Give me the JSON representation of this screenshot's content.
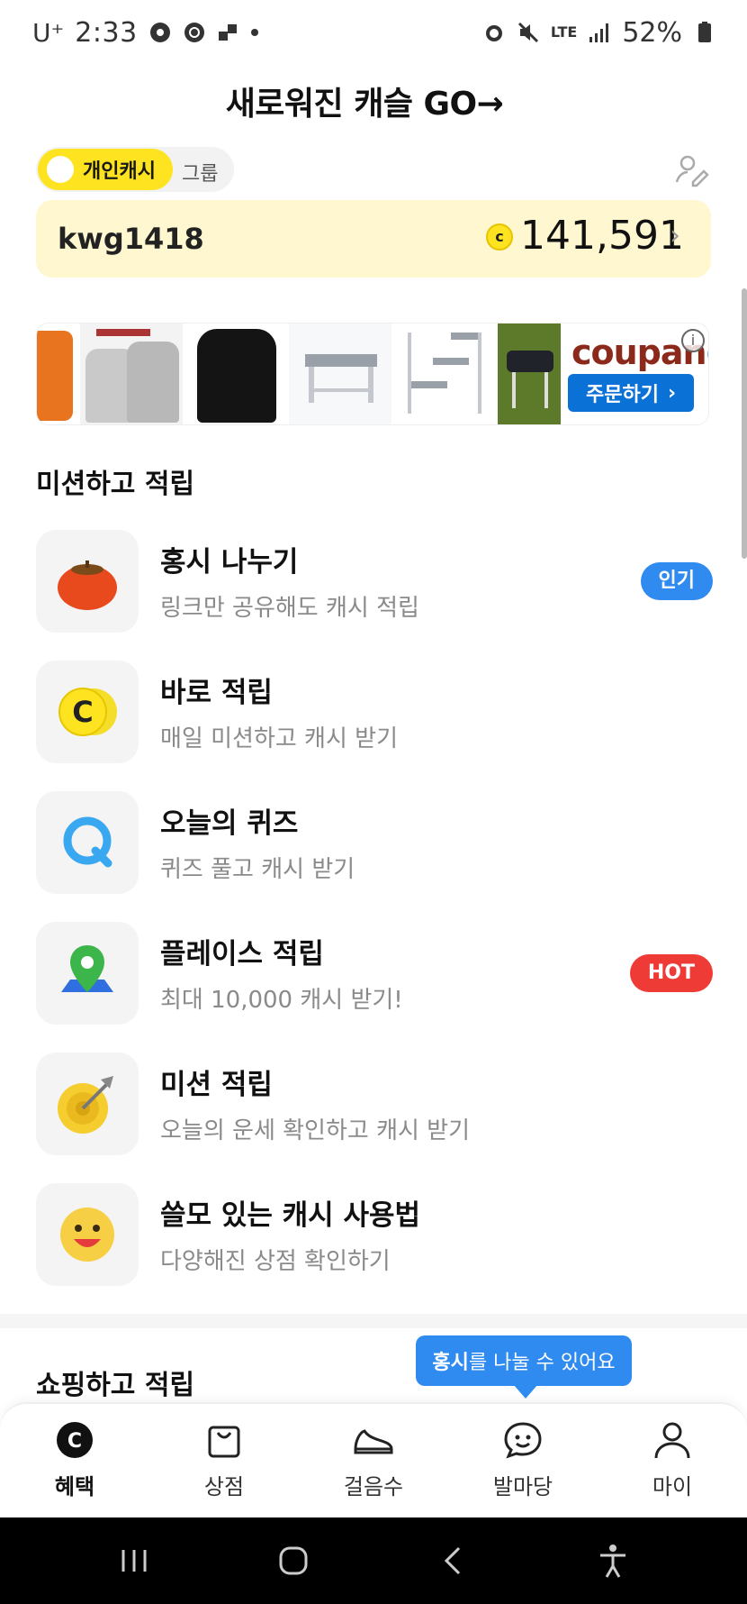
{
  "status_bar": {
    "carrier": "U⁺",
    "time": "2:33",
    "network": "LTE",
    "battery": "52%"
  },
  "header": {
    "title": "새로워진 캐슬  GO→"
  },
  "cash_toggle": {
    "active_label": "개인캐시",
    "inactive_label": "그룹"
  },
  "balance": {
    "user_id": "kwg1418",
    "coin_symbol": "c",
    "amount": "141,591",
    "chevron": "›"
  },
  "ad": {
    "brand_prefix": "coupan",
    "order_button": "주문하기",
    "order_chevron": "›",
    "info_symbol": "i"
  },
  "mission_section": {
    "title": "미션하고 적립",
    "items": [
      {
        "title": "홍시 나누기",
        "subtitle": "링크만 공유해도 캐시 적립",
        "badge": "인기",
        "badge_color": "#2f8bf0",
        "icon": "persimmon-icon"
      },
      {
        "title": "바로 적립",
        "subtitle": "매일 미션하고 캐시 받기",
        "badge": "",
        "icon": "coin-c-icon"
      },
      {
        "title": "오늘의 퀴즈",
        "subtitle": "퀴즈 풀고 캐시 받기",
        "badge": "",
        "icon": "quiz-q-icon"
      },
      {
        "title": "플레이스 적립",
        "subtitle": "최대 10,000 캐시 받기!",
        "badge": "HOT",
        "badge_color": "#ee3b36",
        "icon": "map-pin-icon"
      },
      {
        "title": "미션 적립",
        "subtitle": "오늘의 운세 확인하고 캐시 받기",
        "badge": "",
        "icon": "target-icon"
      },
      {
        "title": "쓸모 있는 캐시 사용법",
        "subtitle": "다양해진 상점 확인하기",
        "badge": "",
        "icon": "smiley-icon"
      }
    ]
  },
  "shopping_section": {
    "title": "쇼핑하고 적립"
  },
  "tooltip": {
    "bold": "홍시",
    "rest": "를 나눌 수 있어요"
  },
  "bottom_nav": {
    "items": [
      {
        "label": "혜택",
        "icon": "benefit-c-icon",
        "active": true
      },
      {
        "label": "상점",
        "icon": "shopping-bag-icon",
        "active": false
      },
      {
        "label": "걸음수",
        "icon": "sneaker-icon",
        "active": false
      },
      {
        "label": "발마당",
        "icon": "chat-smile-icon",
        "active": false
      },
      {
        "label": "마이",
        "icon": "person-icon",
        "active": false
      }
    ]
  },
  "colors": {
    "accent_yellow": "#fde320",
    "balance_bg": "#fff7cf",
    "badge_blue": "#2f8bf0",
    "badge_red": "#ee3b36",
    "coupang_blue": "#0a71d6"
  }
}
